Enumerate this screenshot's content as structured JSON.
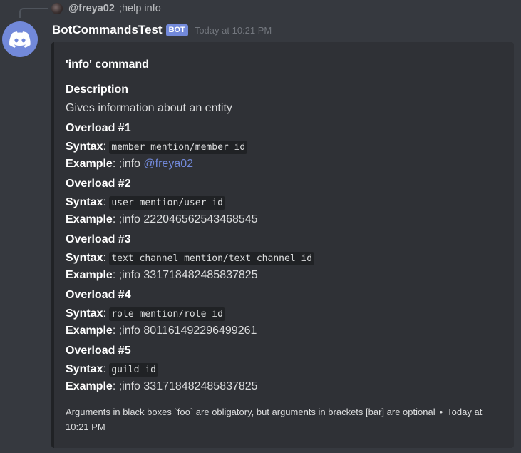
{
  "reply": {
    "author": "@freya02",
    "content": ";help info"
  },
  "message": {
    "author": "BotCommandsTest",
    "bot_tag": "BOT",
    "timestamp": "Today at 10:21 PM"
  },
  "embed": {
    "title": "'info' command",
    "description": {
      "name": "Description",
      "value": "Gives information about an entity"
    },
    "labels": {
      "syntax": "Syntax",
      "example": "Example"
    },
    "overloads": [
      {
        "name": "Overload #1",
        "syntax": "member mention/member id",
        "example_prefix": ";info",
        "example_arg": "@freya02"
      },
      {
        "name": "Overload #2",
        "syntax": "user mention/user id",
        "example_prefix": ";info",
        "example_arg": "222046562543468545"
      },
      {
        "name": "Overload #3",
        "syntax": "text channel mention/text channel id",
        "example_prefix": ";info",
        "example_arg": "331718482485837825"
      },
      {
        "name": "Overload #4",
        "syntax": "role mention/role id",
        "example_prefix": ";info",
        "example_arg": "801161492296499261"
      },
      {
        "name": "Overload #5",
        "syntax": "guild id",
        "example_prefix": ";info",
        "example_arg": "331718482485837825"
      }
    ],
    "footer": {
      "text": "Arguments in black boxes `foo` are obligatory, but arguments in brackets [bar] are optional",
      "separator": "•",
      "timestamp": "Today at 10:21 PM"
    }
  },
  "icons": {
    "avatar": "discord-logo-icon",
    "reply_avatar": "user-avatar-icon"
  }
}
